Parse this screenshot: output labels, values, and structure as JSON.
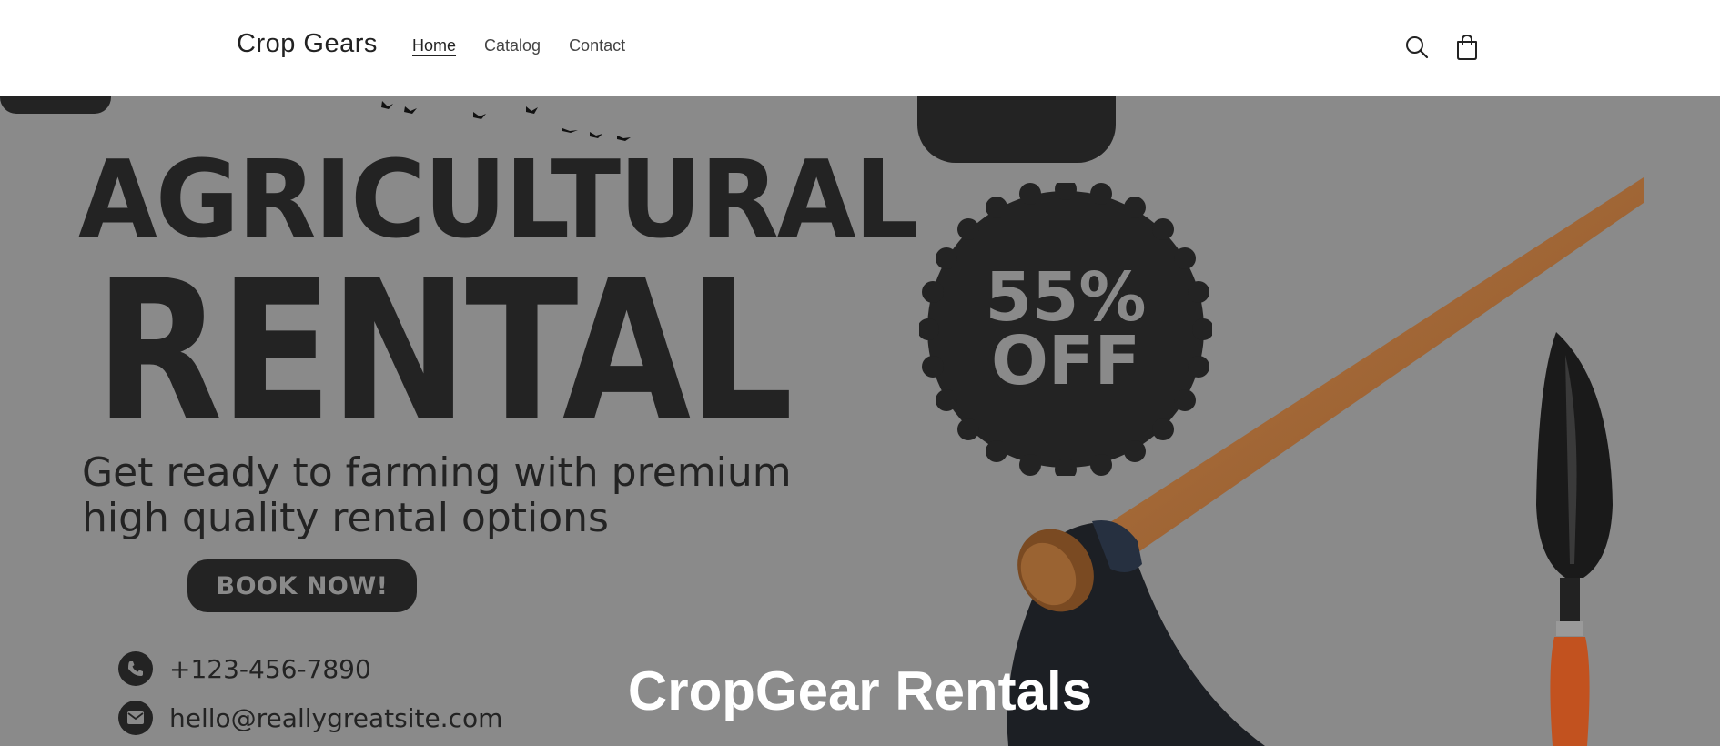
{
  "header": {
    "brand": "Crop Gears",
    "nav": [
      {
        "label": "Home",
        "active": true
      },
      {
        "label": "Catalog",
        "active": false
      },
      {
        "label": "Contact",
        "active": false
      }
    ],
    "icons": [
      "search-icon",
      "cart-icon"
    ]
  },
  "hero": {
    "headline_1": "AGRICULTURAL",
    "headline_2": "RENTAL",
    "subtitle_line_1": "Get ready to farming with premium",
    "subtitle_line_2": "high quality rental options",
    "cta": "BOOK NOW!",
    "badge_percent": "55%",
    "badge_off": "OFF",
    "phone": "+123-456-7890",
    "email": "hello@reallygreatsite.com",
    "overlay_title": "CropGear Rentals"
  },
  "colors": {
    "header_bg": "#ffffff",
    "hero_bg": "#8a8a8a",
    "dark": "#232323",
    "handle": "#a86e3c",
    "trowel_handle": "#c2521f"
  }
}
